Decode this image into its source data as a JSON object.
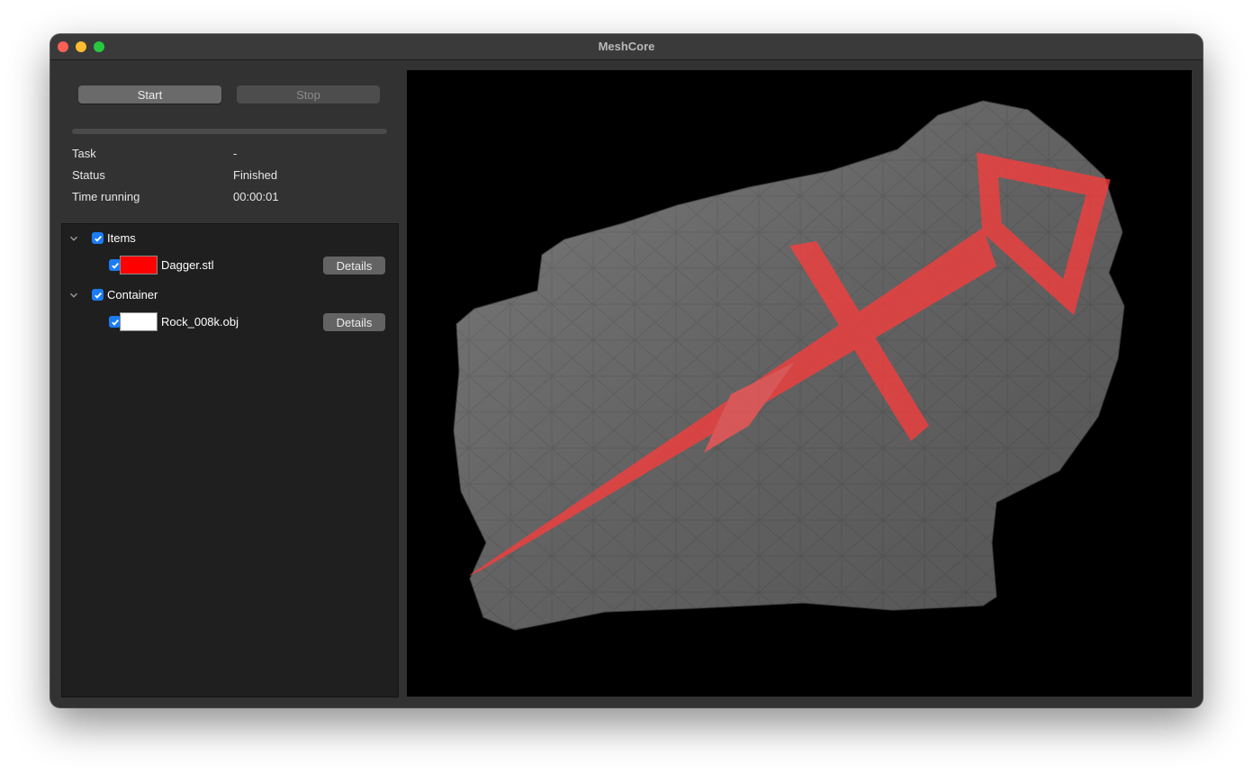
{
  "window": {
    "title": "MeshCore"
  },
  "controls": {
    "start_label": "Start",
    "stop_label": "Stop",
    "progress": 0
  },
  "info": {
    "task_label": "Task",
    "task_value": "-",
    "status_label": "Status",
    "status_value": "Finished",
    "time_label": "Time running",
    "time_value": "00:00:01"
  },
  "tree": {
    "groups": [
      {
        "label": "Items",
        "checked": true,
        "items": [
          {
            "name": "Dagger.stl",
            "color": "#ff0000",
            "checked": true,
            "details_label": "Details"
          }
        ]
      },
      {
        "label": "Container",
        "checked": true,
        "items": [
          {
            "name": "Rock_008k.obj",
            "color": "#ffffff",
            "checked": true,
            "details_label": "Details"
          }
        ]
      }
    ]
  },
  "viewport": {
    "background": "#000000",
    "rock_color": "#6b6b6b",
    "dagger_color": "#ff3b3b"
  }
}
